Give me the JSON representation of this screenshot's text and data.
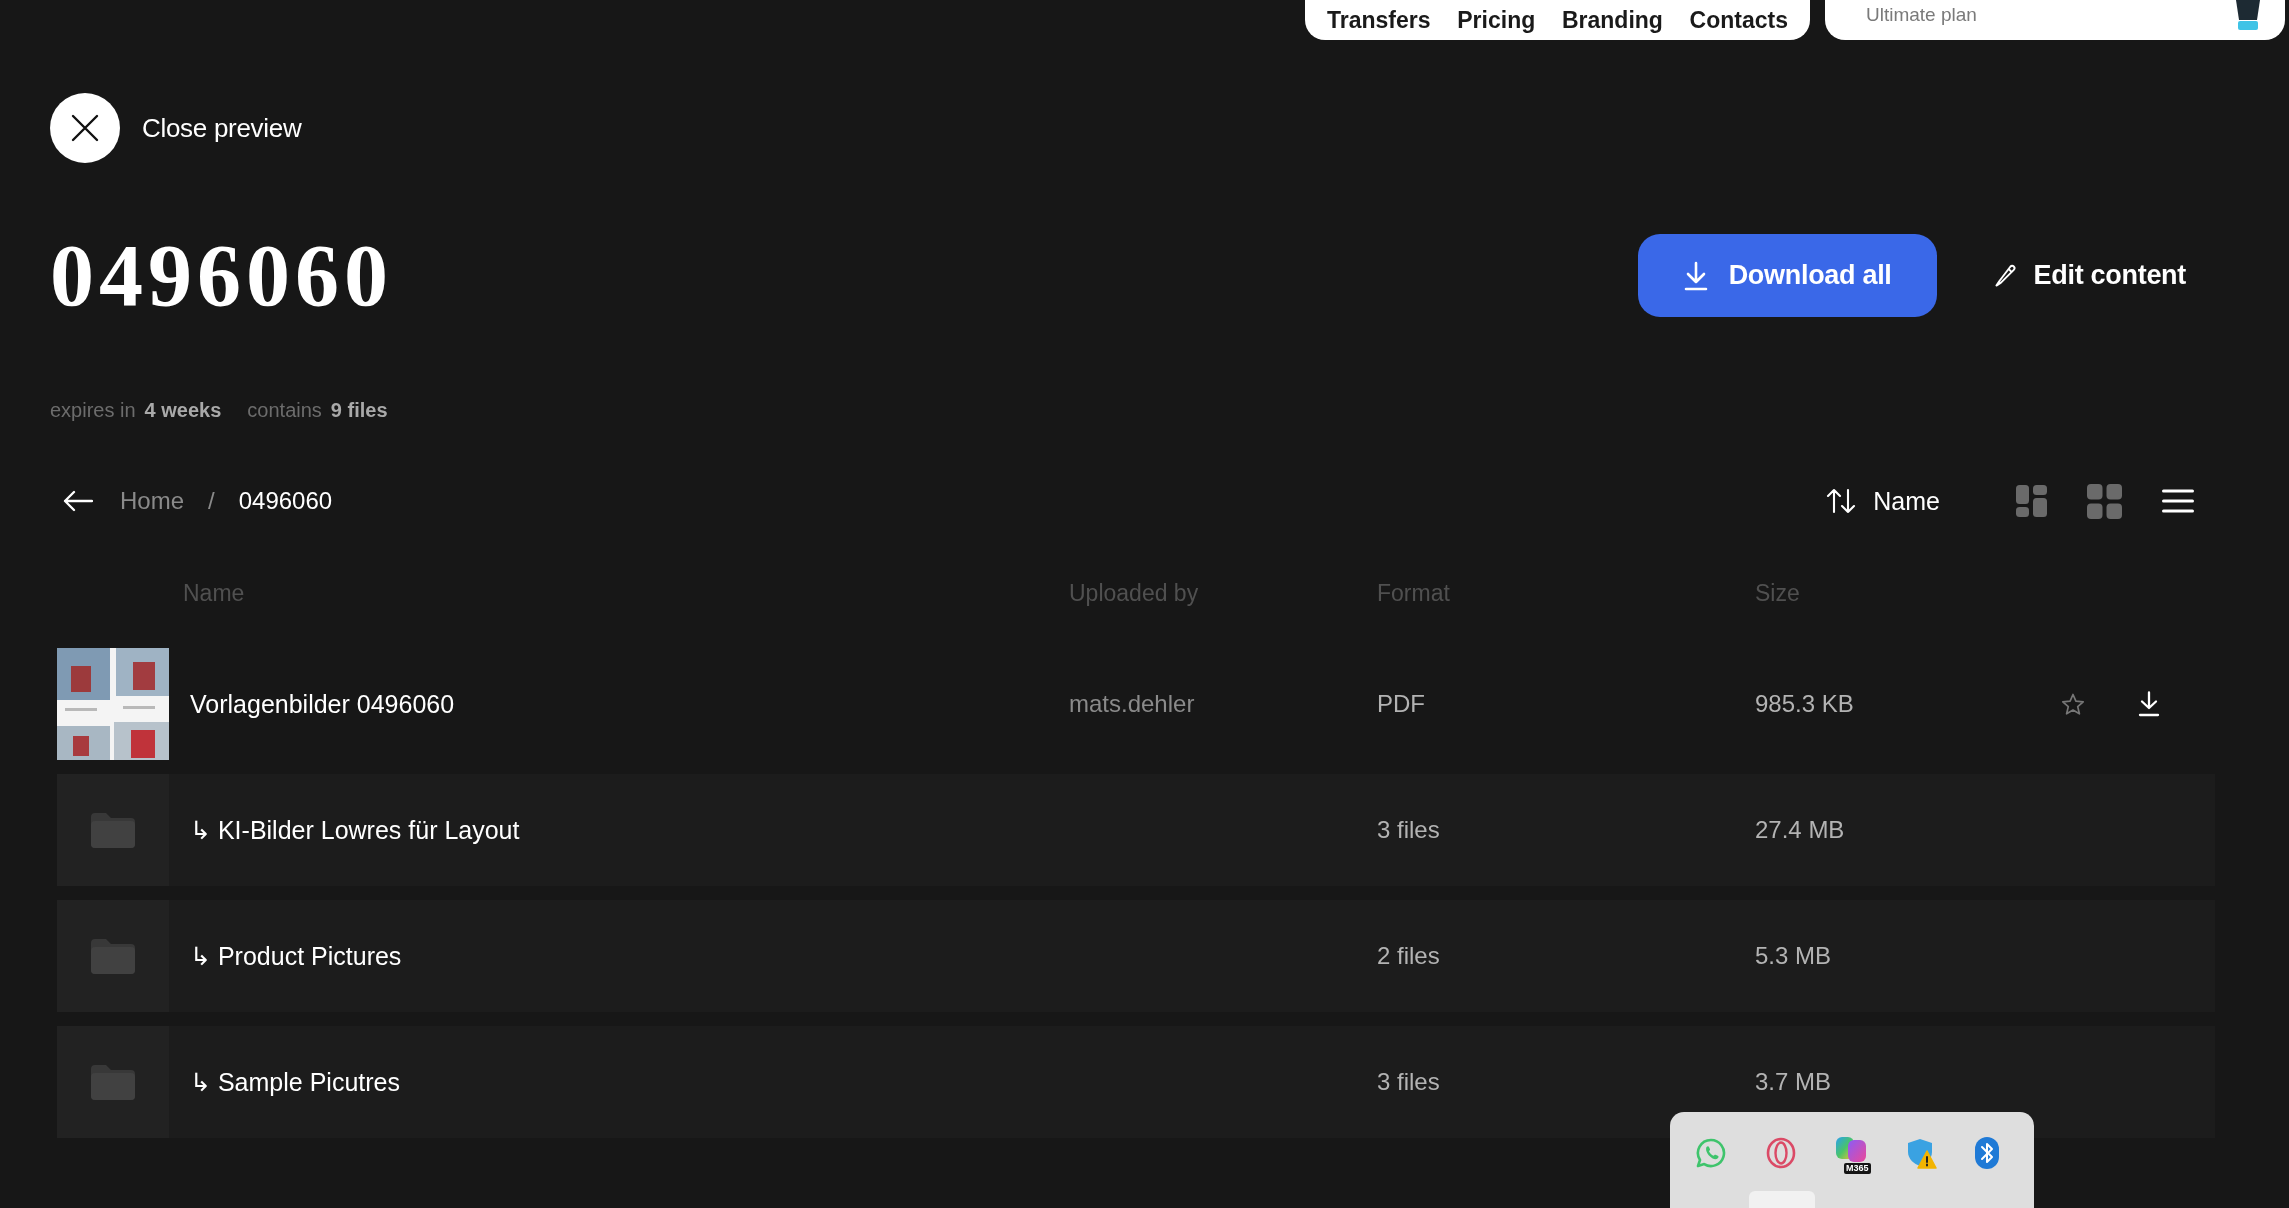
{
  "top_nav": {
    "links": [
      "Transfers",
      "Pricing",
      "Branding",
      "Contacts"
    ],
    "account": {
      "plan": "Ultimate plan"
    }
  },
  "close_preview": {
    "label": "Close preview"
  },
  "title": "0496060",
  "actions": [
    {
      "kind": "download",
      "label": "Download all"
    },
    {
      "kind": "edit",
      "label": "Edit content"
    }
  ],
  "meta": [
    {
      "label": "expires in",
      "value": "4 weeks"
    },
    {
      "label": "contains",
      "value": "9 files"
    }
  ],
  "breadcrumb": {
    "separator": "/",
    "items": [
      {
        "label": "Home",
        "current": false
      },
      {
        "label": "0496060",
        "current": true
      }
    ]
  },
  "sort": {
    "label": "Name"
  },
  "view_modes": [
    {
      "kind": "masonry",
      "selected": false
    },
    {
      "kind": "grid",
      "selected": false
    },
    {
      "kind": "list",
      "selected": true
    }
  ],
  "table": {
    "columns": [
      "Name",
      "Uploaded by",
      "Format",
      "Size"
    ],
    "rows": [
      {
        "kind": "file",
        "name": "Vorlagenbilder 0496060",
        "uploaded_by": "mats.dehler",
        "format": "PDF",
        "size": "985.3 KB",
        "hovered": true,
        "starred": false
      },
      {
        "kind": "folder",
        "name": "↳ KI-Bilder Lowres für Layout",
        "format": "3 files",
        "size": "27.4 MB",
        "hovered": false,
        "starred": false
      },
      {
        "kind": "folder",
        "name": "↳ Product Pictures",
        "format": "2 files",
        "size": "5.3 MB",
        "hovered": false,
        "starred": false
      },
      {
        "kind": "folder",
        "name": "↳ Sample Picutres",
        "format": "3 files",
        "size": "3.7 MB",
        "hovered": false,
        "starred": false
      }
    ]
  },
  "tray": {
    "icons": [
      {
        "kind": "chat"
      },
      {
        "kind": "ring"
      },
      {
        "kind": "apps",
        "badge": "M365"
      },
      {
        "kind": "shield-warning"
      },
      {
        "kind": "bluetooth"
      }
    ]
  }
}
